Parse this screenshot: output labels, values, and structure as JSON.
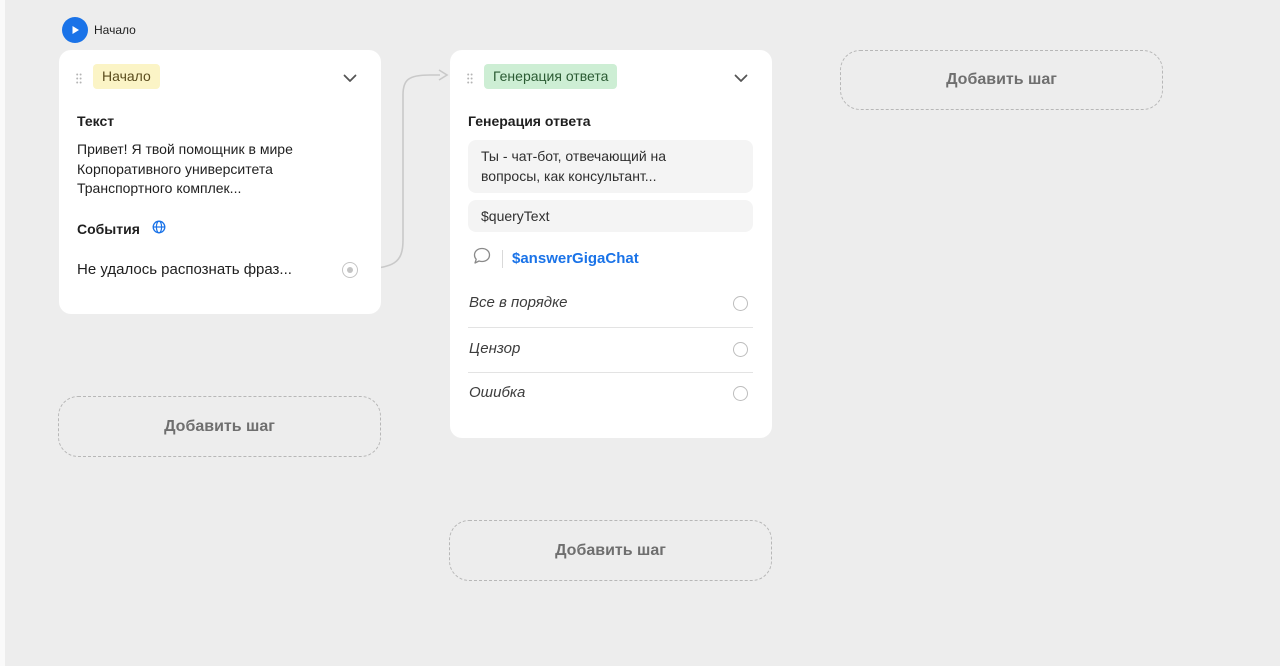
{
  "start": {
    "label": "Начало"
  },
  "card1": {
    "tag": "Начало",
    "text_title": "Текст",
    "text_lines": [
      "Привет! Я твой помощник в мире",
      "Корпоративного университета",
      "Транспортного комплек..."
    ],
    "events_title": "События",
    "event_item": "Не удалось распознать фраз..."
  },
  "card2": {
    "tag": "Генерация ответа",
    "title": "Генерация ответа",
    "prompt_lines": [
      "Ты - чат-бот, отвечающий на",
      "вопросы, как консультант..."
    ],
    "input_value": "$queryText",
    "variable": "$answerGigaChat",
    "options": [
      "Все в порядке",
      "Цензор",
      "Ошибка"
    ]
  },
  "add_step": {
    "label": "Добавить шаг"
  },
  "colors": {
    "accent": "#1a73e8",
    "tag_start_bg": "#fbf4c6",
    "tag_gen_bg": "#cdeed4",
    "canvas_bg": "#ededed"
  }
}
